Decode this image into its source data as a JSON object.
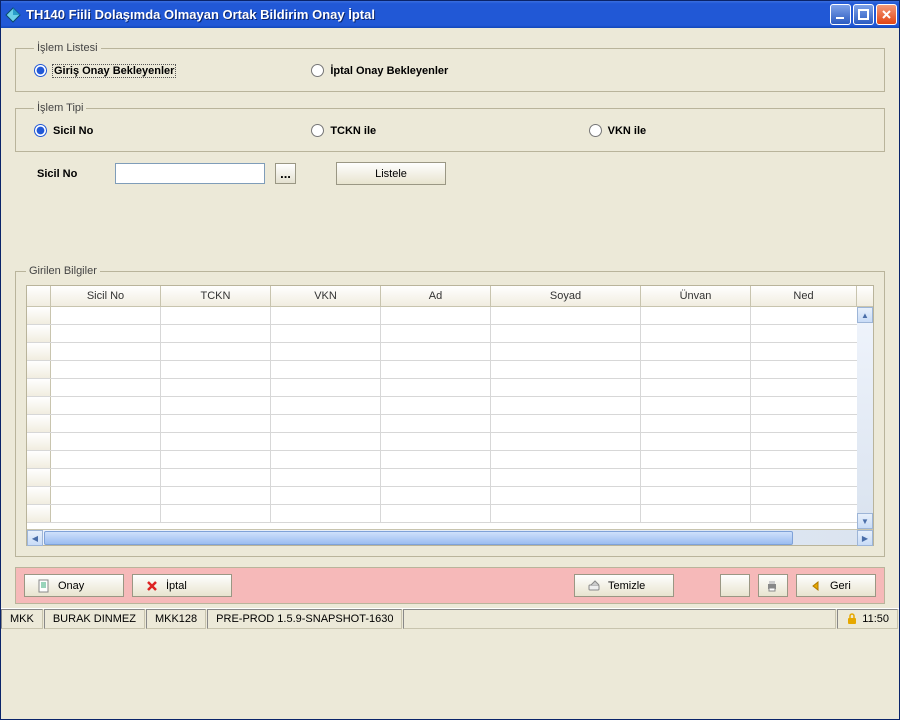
{
  "window": {
    "title": "TH140 Fiili Dolaşımda Olmayan Ortak Bildirim Onay İptal"
  },
  "groups": {
    "islem_listesi": {
      "legend": "İşlem Listesi",
      "opt_giris": "Giriş Onay Bekleyenler",
      "opt_iptal": "İptal Onay Bekleyenler"
    },
    "islem_tipi": {
      "legend": "İşlem Tipi",
      "opt_sicil": "Sicil No",
      "opt_tckn": "TCKN ile",
      "opt_vkn": "VKN ile"
    },
    "search": {
      "label": "Sicil No",
      "value": "",
      "listele": "Listele"
    },
    "grid": {
      "legend": "Girilen Bilgiler",
      "columns": {
        "c1": "Sicil No",
        "c2": "TCKN",
        "c3": "VKN",
        "c4": "Ad",
        "c5": "Soyad",
        "c6": "Ünvan",
        "c7": "Ned"
      }
    }
  },
  "actions": {
    "onay": "Onay",
    "iptal": "İptal",
    "temizle": "Temizle",
    "geri": "Geri"
  },
  "status": {
    "s1": "MKK",
    "s2": "BURAK DINMEZ",
    "s3": "MKK128",
    "s4": "PRE-PROD 1.5.9-SNAPSHOT-1630",
    "time": "11:50"
  }
}
